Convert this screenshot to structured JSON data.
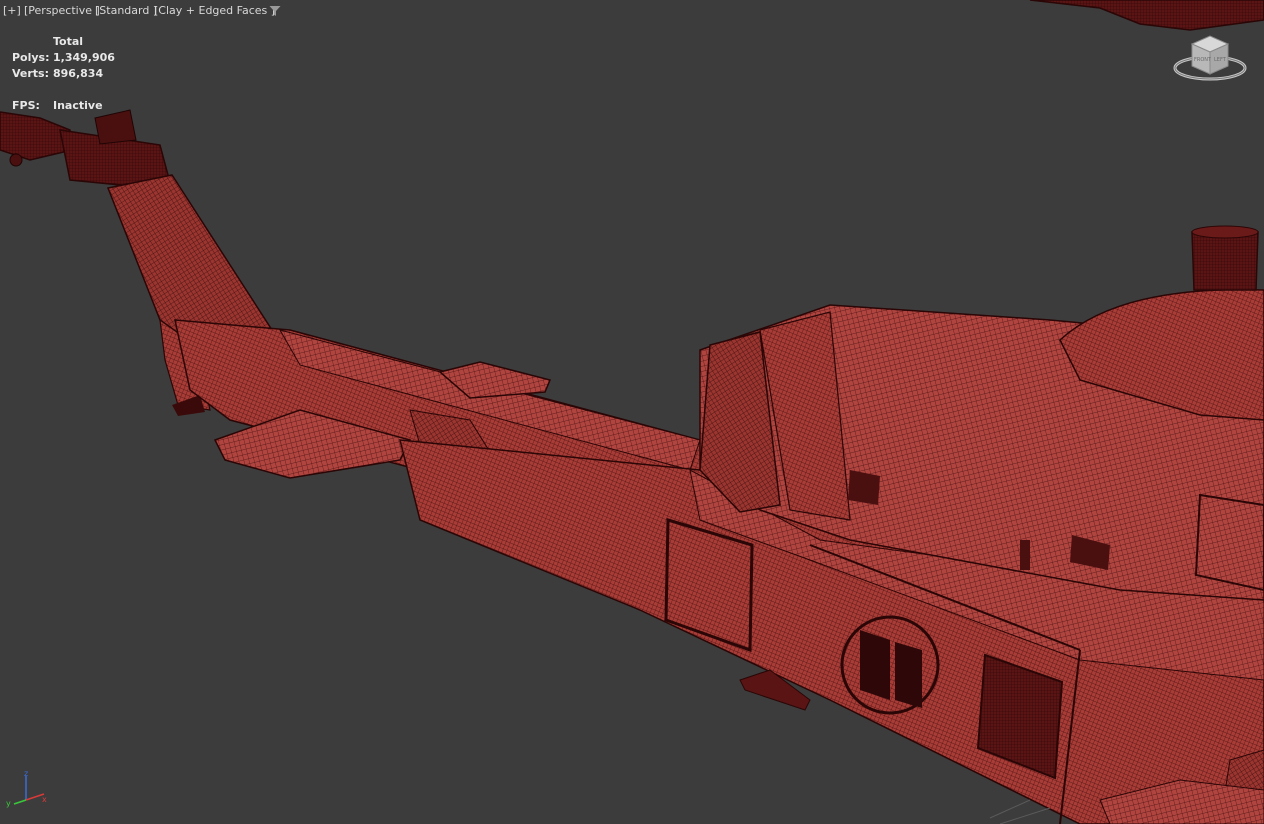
{
  "viewport": {
    "labels": {
      "plus": "[+]",
      "camera": "[Perspective ]",
      "shading_preset": "[Standard ]",
      "display_mode": "[Clay + Edged Faces ]"
    },
    "stats": {
      "header": "Total",
      "polys_label": "Polys:",
      "polys_value": "1,349,906",
      "verts_label": "Verts:",
      "verts_value": "896,834",
      "fps_label": "FPS:",
      "fps_value": "Inactive"
    },
    "viewcube": {
      "faces": [
        "TOP",
        "FRONT",
        "LEFT"
      ]
    },
    "axis_tripod": {
      "axes": [
        "x",
        "y",
        "z"
      ]
    }
  },
  "colors": {
    "background": "#3c3c3c",
    "clay": "#a53a35",
    "wire": "#3a0a0a",
    "text": "#d8d8d8"
  },
  "icons": {
    "filter": "funnel-icon",
    "viewcube": "viewcube-icon",
    "axes": "axis-tripod-icon"
  }
}
